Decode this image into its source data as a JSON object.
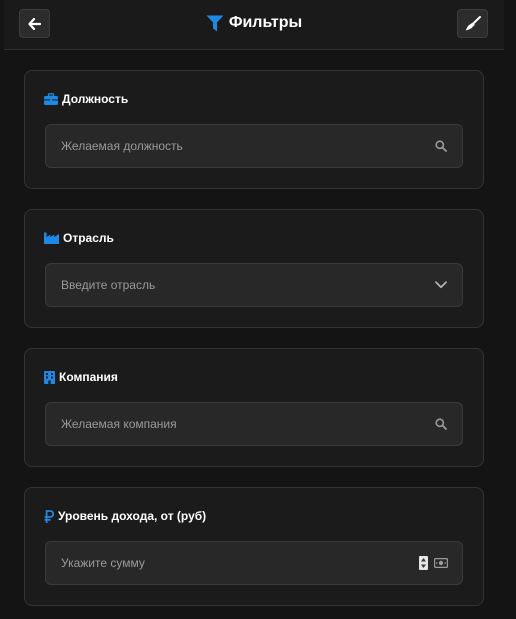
{
  "header": {
    "title": "Фильтры",
    "accent_color": "#1e88e5"
  },
  "filters": {
    "position": {
      "label": "Должность",
      "placeholder": "Желаемая должность",
      "icon": "briefcase-icon"
    },
    "industry": {
      "label": "Отрасль",
      "placeholder": "Введите отрасль",
      "icon": "industry-icon"
    },
    "company": {
      "label": "Компания",
      "placeholder": "Желаемая компания",
      "icon": "building-icon"
    },
    "income": {
      "label": "Уровень дохода, от (руб)",
      "placeholder": "Укажите сумму",
      "icon": "ruble-icon"
    }
  }
}
